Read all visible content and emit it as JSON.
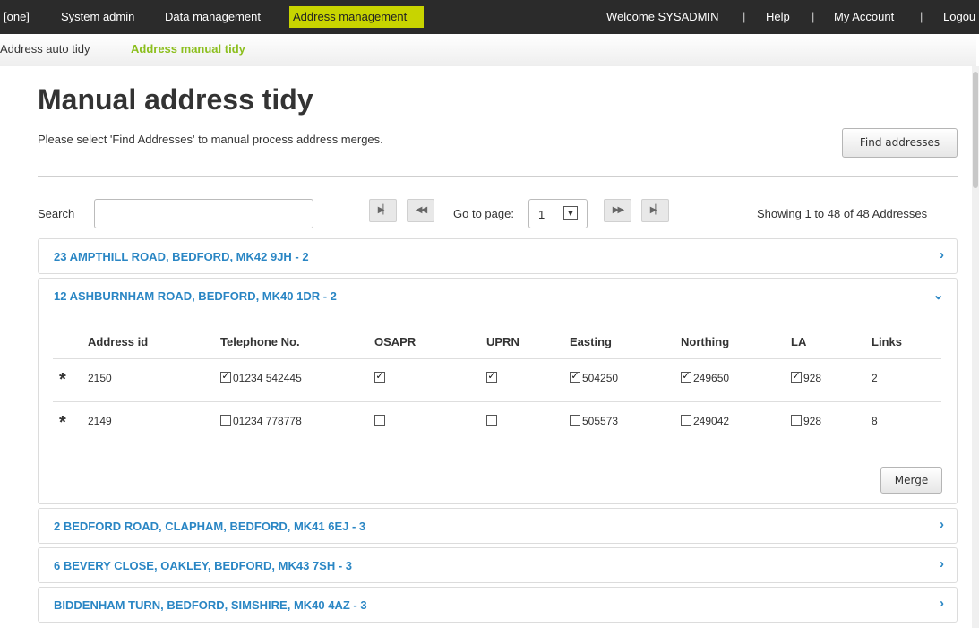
{
  "topnav": {
    "brand": "[one]",
    "system_admin": "System admin",
    "data_management": "Data management",
    "address_management": "Address management",
    "welcome": "Welcome SYSADMIN",
    "help": "Help",
    "my_account": "My Account",
    "logout": "Logou",
    "separator": "|",
    "accent_color": "#c8d400"
  },
  "subnav": {
    "auto_tidy": "Address auto tidy",
    "manual_tidy": "Address manual tidy"
  },
  "page": {
    "title": "Manual address tidy",
    "intro": "Please select 'Find Addresses' to manual process address merges.",
    "find_button": "Find addresses"
  },
  "search": {
    "label": "Search",
    "value": ""
  },
  "pagination": {
    "first_icon": "first-page-icon",
    "prev_icon": "prev-page-icon",
    "goto_label": "Go to page:",
    "page_value": "1",
    "next_icon": "next-page-icon",
    "last_icon": "last-page-icon",
    "showing": "Showing 1 to 48 of 48 Addresses"
  },
  "groups": [
    {
      "title": "23 AMPTHILL ROAD, BEDFORD, MK42 9JH - 2",
      "expanded": false
    },
    {
      "title": "12 ASHBURNHAM ROAD, BEDFORD, MK40 1DR - 2",
      "expanded": true
    },
    {
      "title": "2 BEDFORD ROAD, CLAPHAM, BEDFORD, MK41 6EJ - 3",
      "expanded": false
    },
    {
      "title": "6 BEVERY CLOSE, OAKLEY, BEDFORD, MK43 7SH - 3",
      "expanded": false
    },
    {
      "title": "BIDDENHAM TURN, BEDFORD, SIMSHIRE, MK40 4AZ - 3",
      "expanded": false
    }
  ],
  "table": {
    "headers": [
      "Address id",
      "Telephone No.",
      "OSAPR",
      "UPRN",
      "Easting",
      "Northing",
      "LA",
      "Links"
    ],
    "rows": [
      {
        "marker": "*",
        "id": "2150",
        "phone": "01234 542445",
        "phone_checked": true,
        "osapr_checked": true,
        "uprn_checked": true,
        "easting": "504250",
        "easting_checked": true,
        "northing": "249650",
        "northing_checked": true,
        "la": "928",
        "la_checked": true,
        "links": "2"
      },
      {
        "marker": "*",
        "id": "2149",
        "phone": "01234 778778",
        "phone_checked": false,
        "osapr_checked": false,
        "uprn_checked": false,
        "easting": "505573",
        "easting_checked": false,
        "northing": "249042",
        "northing_checked": false,
        "la": "928",
        "la_checked": false,
        "links": "8"
      }
    ],
    "merge_button": "Merge",
    "check_mark": "✓"
  }
}
